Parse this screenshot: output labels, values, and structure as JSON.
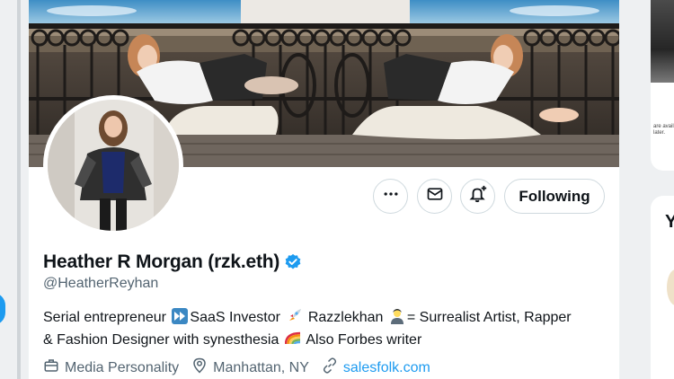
{
  "profile": {
    "name": "Heather R Morgan (rzk.eth)",
    "handle": "@HeatherReyhan",
    "verified": true,
    "bio_line1": "Serial entrepreneur ",
    "bio_saas": "SaaS Investor ",
    "bio_after_rocket": " Razzlekhan ",
    "bio_surreal": "= Surrealist Artist, Rapper",
    "bio_line2": "& Fashion Designer with synesthesia ",
    "bio_end": " Also Forbes writer",
    "category": "Media Personality",
    "location": "Manhattan, NY",
    "website": "salesfolk.com"
  },
  "actions": {
    "more_label": "More",
    "message_label": "Message",
    "notify_label": "Turn on notifications",
    "following_label": "Following"
  },
  "right_rail": {
    "heading_fragment": "Y",
    "tiny_text": "are availabl later."
  },
  "colors": {
    "accent": "#1d9bf0",
    "text_primary": "#0f1419",
    "text_secondary": "#536471",
    "border": "#cfd9de"
  },
  "icons": {
    "more": "more-horizontal-icon",
    "message": "envelope-icon",
    "notify": "bell-plus-icon",
    "verified": "verified-badge-icon",
    "category": "briefcase-icon",
    "location": "location-pin-icon",
    "website": "link-icon",
    "emoji_fastforward": "fast-forward-emoji",
    "emoji_rocket": "rocket-emoji",
    "emoji_artist": "artist-emoji",
    "emoji_rainbow": "rainbow-emoji"
  }
}
